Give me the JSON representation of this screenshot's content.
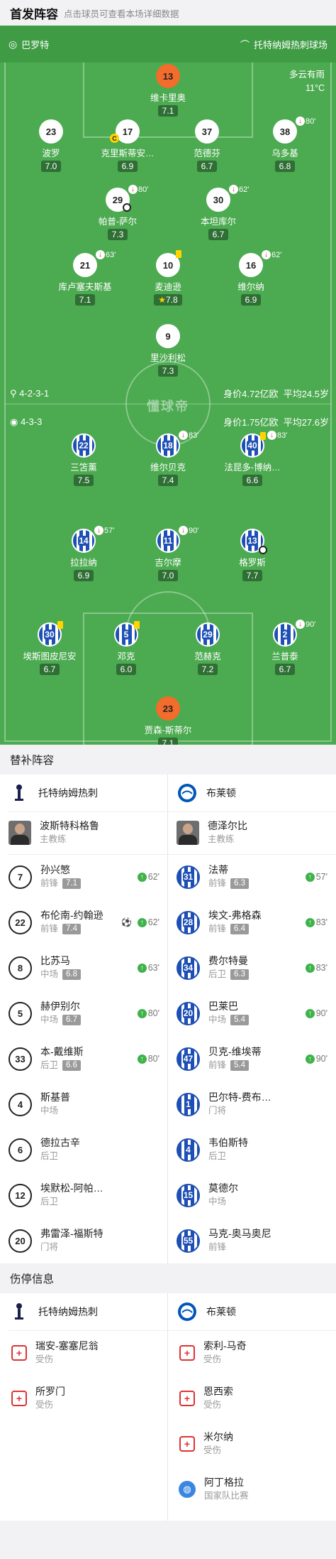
{
  "header": {
    "title": "首发阵容",
    "subtitle": "点击球员可查看本场详细数据"
  },
  "pitch": {
    "referee": "巴罗特",
    "stadium": "托特纳姆热刺球场",
    "weather": "多云有雨",
    "temperature": "11°C",
    "home_formation": "4-2-3-1",
    "home_value": "身价4.72亿欧",
    "home_age": "平均24.5岁",
    "away_formation": "4-3-3",
    "away_value": "身价1.75亿欧",
    "away_age": "平均27.6岁",
    "watermark": "懂球帝"
  },
  "home_players": [
    {
      "num": "13",
      "name": "维卡里奥",
      "rating": "7.1"
    },
    {
      "num": "23",
      "name": "波罗",
      "rating": "7.0"
    },
    {
      "num": "17",
      "name": "克里斯蒂安…",
      "rating": "6.9"
    },
    {
      "num": "37",
      "name": "范德芬",
      "rating": "6.7"
    },
    {
      "num": "38",
      "name": "乌多基",
      "rating": "6.8",
      "sub": "80'"
    },
    {
      "num": "29",
      "name": "帕普-萨尔",
      "rating": "7.3",
      "sub": "80'"
    },
    {
      "num": "30",
      "name": "本坦库尔",
      "rating": "6.7",
      "sub": "62'"
    },
    {
      "num": "21",
      "name": "库卢塞夫斯基",
      "rating": "7.1",
      "sub": "63'"
    },
    {
      "num": "10",
      "name": "麦迪逊",
      "rating": "7.8"
    },
    {
      "num": "16",
      "name": "维尔纳",
      "rating": "6.9",
      "sub": "62'"
    },
    {
      "num": "9",
      "name": "里沙利松",
      "rating": "7.3"
    }
  ],
  "away_players": [
    {
      "num": "22",
      "name": "三笘薰",
      "rating": "7.5"
    },
    {
      "num": "18",
      "name": "维尔贝克",
      "rating": "7.4",
      "sub": "83'"
    },
    {
      "num": "40",
      "name": "法昆多-博纳…",
      "rating": "6.6",
      "sub": "83'"
    },
    {
      "num": "14",
      "name": "拉拉纳",
      "rating": "6.9",
      "sub": "57'"
    },
    {
      "num": "11",
      "name": "吉尔摩",
      "rating": "7.0",
      "sub": "90'"
    },
    {
      "num": "13",
      "name": "格罗斯",
      "rating": "7.7"
    },
    {
      "num": "30",
      "name": "埃斯图皮尼安",
      "rating": "6.7"
    },
    {
      "num": "5",
      "name": "邓克",
      "rating": "6.0"
    },
    {
      "num": "29",
      "name": "范赫克",
      "rating": "7.2"
    },
    {
      "num": "2",
      "name": "兰普泰",
      "rating": "6.7",
      "sub": "90'"
    },
    {
      "num": "23",
      "name": "贾森-斯蒂尔",
      "rating": "7.1"
    }
  ],
  "subs_title": "替补阵容",
  "home_team": "托特纳姆热刺",
  "away_team": "布莱顿",
  "home_coach": {
    "name": "波斯特科格鲁",
    "role": "主教练"
  },
  "away_coach": {
    "name": "德泽尔比",
    "role": "主教练"
  },
  "home_subs": [
    {
      "num": "7",
      "name": "孙兴慜",
      "pos": "前锋",
      "rating": "7.1",
      "in": "62'"
    },
    {
      "num": "22",
      "name": "布伦南-约翰逊",
      "pos": "前锋",
      "rating": "7.4",
      "in": "62'"
    },
    {
      "num": "8",
      "name": "比苏马",
      "pos": "中场",
      "rating": "6.8",
      "in": "63'"
    },
    {
      "num": "5",
      "name": "赫伊别尔",
      "pos": "中场",
      "rating": "6.7",
      "in": "80'"
    },
    {
      "num": "33",
      "name": "本-戴维斯",
      "pos": "后卫",
      "rating": "6.6",
      "in": "80'"
    },
    {
      "num": "4",
      "name": "斯基普",
      "pos": "中场"
    },
    {
      "num": "6",
      "name": "德拉古辛",
      "pos": "后卫"
    },
    {
      "num": "12",
      "name": "埃默松-阿帕…",
      "pos": "后卫"
    },
    {
      "num": "20",
      "name": "弗雷泽-福斯特",
      "pos": "门将"
    }
  ],
  "away_subs": [
    {
      "num": "31",
      "name": "法蒂",
      "pos": "前锋",
      "rating": "6.3",
      "in": "57'"
    },
    {
      "num": "28",
      "name": "埃文-弗格森",
      "pos": "前锋",
      "rating": "6.4",
      "in": "83'"
    },
    {
      "num": "34",
      "name": "费尔特曼",
      "pos": "后卫",
      "rating": "6.3",
      "in": "83'"
    },
    {
      "num": "20",
      "name": "巴莱巴",
      "pos": "中场",
      "rating": "5.4",
      "in": "90'"
    },
    {
      "num": "47",
      "name": "贝克-维埃蒂",
      "pos": "前锋",
      "rating": "5.4",
      "in": "90'"
    },
    {
      "num": "1",
      "name": "巴尔特-费布…",
      "pos": "门将"
    },
    {
      "num": "4",
      "name": "韦伯斯特",
      "pos": "后卫"
    },
    {
      "num": "15",
      "name": "莫德尔",
      "pos": "中场"
    },
    {
      "num": "55",
      "name": "马克-奥马奥尼",
      "pos": "前锋"
    }
  ],
  "injury_title": "伤停信息",
  "home_injuries": [
    {
      "name": "瑞安-塞塞尼翁",
      "status": "受伤"
    },
    {
      "name": "所罗门",
      "status": "受伤"
    }
  ],
  "away_injuries": [
    {
      "name": "索利-马奇",
      "status": "受伤"
    },
    {
      "name": "恩西索",
      "status": "受伤"
    },
    {
      "name": "米尔纳",
      "status": "受伤"
    },
    {
      "name": "阿丁格拉",
      "status": "国家队比赛"
    }
  ]
}
